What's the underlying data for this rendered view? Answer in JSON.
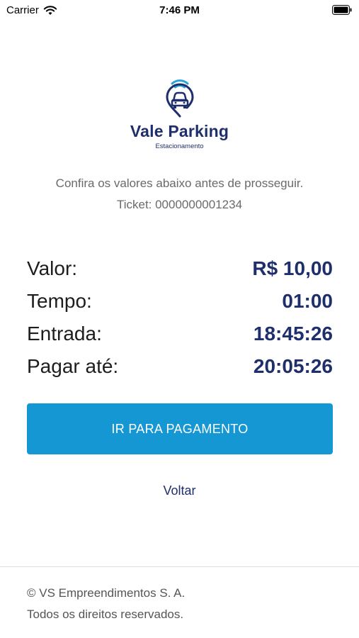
{
  "status_bar": {
    "carrier": "Carrier",
    "time": "7:46 PM"
  },
  "logo": {
    "name": "Vale Parking",
    "subtitle": "Estacionamento"
  },
  "intro": {
    "message": "Confira os valores abaixo antes de prosseguir.",
    "ticket": "Ticket: 0000000001234"
  },
  "values": [
    {
      "label": "Valor:",
      "value": "R$ 10,00"
    },
    {
      "label": "Tempo:",
      "value": "01:00"
    },
    {
      "label": "Entrada:",
      "value": "18:45:26"
    },
    {
      "label": "Pagar até:",
      "value": "20:05:26"
    }
  ],
  "actions": {
    "pay_label": "IR PARA PAGAMENTO",
    "back_label": "Voltar"
  },
  "footer": {
    "line1": "© VS Empreendimentos S. A.",
    "line2": "Todos os direitos reservados."
  },
  "colors": {
    "brand": "#1f2f6b",
    "button": "#1597d3",
    "logo_signal": "#2aa3dc"
  },
  "icons": {
    "wifi": "wifi-icon",
    "battery": "battery-icon",
    "logo": "parking-car-pin-logo"
  }
}
